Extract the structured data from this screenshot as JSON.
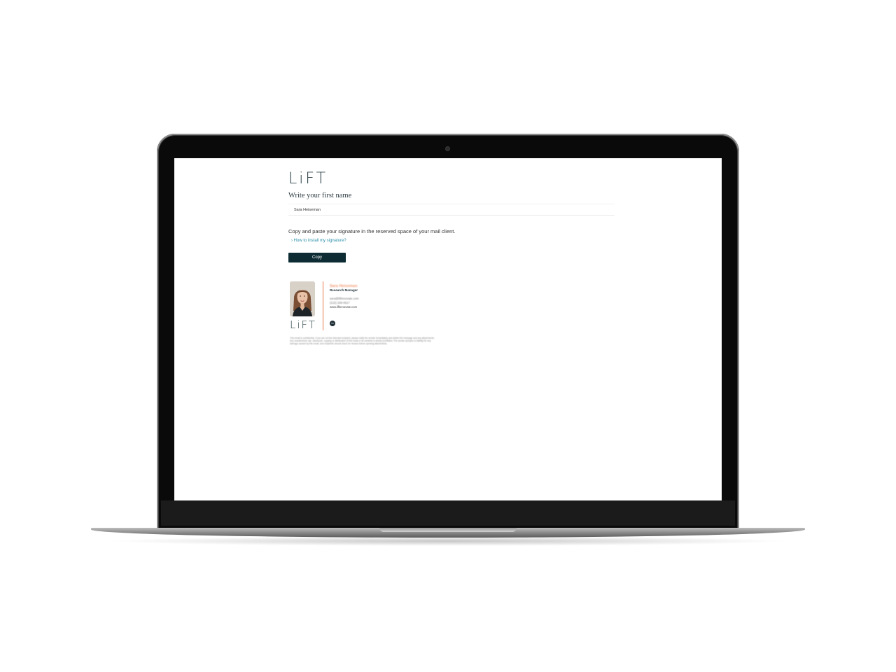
{
  "brand": {
    "logo_text": "LiFT"
  },
  "form": {
    "heading": "Write your first name",
    "name_value": "Sara Heiseman",
    "instructions": "Copy and paste your signature in the reserved space of your mail client.",
    "how_to_link": "› How to install my signature?",
    "copy_label": "Copy"
  },
  "signature": {
    "name": "Sara Heiseman",
    "title": "Research Manager",
    "email": "sara@liftinnovate.com",
    "phone": "(215) 299-0617",
    "website": "www.liftinnovate.com",
    "social_icon": "linkedin-icon",
    "social_glyph": "in",
    "logo_text": "LiFT",
    "disclaimer": "This email is confidential. If you are not the intended recipient, please notify the sender immediately and delete this message and any attachments. Any unauthorized use, disclosure, copying or distribution of this email or its contents is strictly prohibited. The sender accepts no liability for any damage caused by this email, and recipients should check for viruses before opening attachments."
  },
  "colors": {
    "brand_dark": "#0d2b33",
    "link": "#2a8fa8",
    "accent_orange": "#e77a4c"
  }
}
